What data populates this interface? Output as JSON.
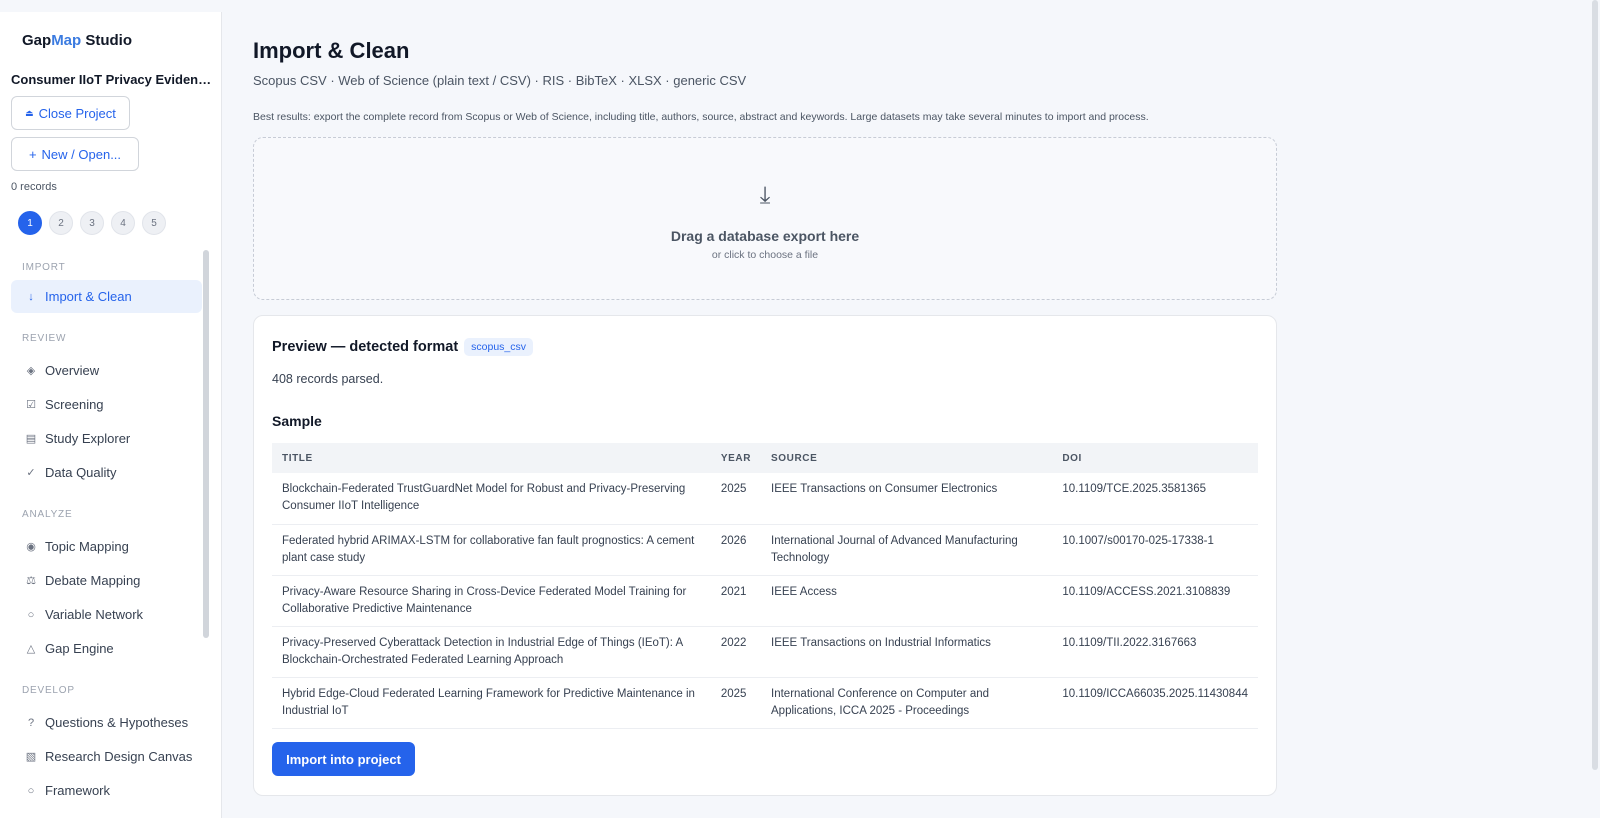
{
  "app": {
    "brand_primary": "Gap",
    "brand_accent": "Map",
    "brand_suffix": " Studio"
  },
  "project": {
    "name": "Consumer IIoT Privacy Evidence ...",
    "close_label": "Close Project",
    "new_label": "New / Open...",
    "records": "0 records"
  },
  "steps": [
    "1",
    "2",
    "3",
    "4",
    "5"
  ],
  "nav": {
    "import_section": "IMPORT",
    "import_clean": "Import & Clean",
    "review_section": "REVIEW",
    "overview": "Overview",
    "screening": "Screening",
    "study_explorer": "Study Explorer",
    "data_quality": "Data Quality",
    "analyze_section": "ANALYZE",
    "topic_mapping": "Topic Mapping",
    "debate_mapping": "Debate Mapping",
    "variable_network": "Variable Network",
    "gap_engine": "Gap Engine",
    "develop_section": "DEVELOP",
    "questions": "Questions & Hypotheses",
    "research_design": "Research Design Canvas",
    "framework": "Framework"
  },
  "main": {
    "title": "Import & Clean",
    "formats": "Scopus CSV · Web of Science (plain text / CSV) · RIS · BibTeX · XLSX · generic CSV",
    "hint": "Best results: export the complete record from Scopus or Web of Science, including title, authors, source, abstract and keywords. Large datasets may take several minutes to import and process.",
    "dropzone_title": "Drag a database export here",
    "dropzone_sub": "or click to choose a file"
  },
  "preview": {
    "title": "Preview — detected format",
    "format_badge": "scopus_csv",
    "parsed": "408 records parsed.",
    "sample_label": "Sample",
    "columns": {
      "title": "TITLE",
      "year": "YEAR",
      "source": "SOURCE",
      "doi": "DOI"
    },
    "rows": [
      {
        "title": "Blockchain-Federated TrustGuardNet Model for Robust and Privacy-Preserving Consumer IIoT Intelligence",
        "year": "2025",
        "source": "IEEE Transactions on Consumer Electronics",
        "doi": "10.1109/TCE.2025.3581365"
      },
      {
        "title": "Federated hybrid ARIMAX-LSTM for collaborative fan fault prognostics: A cement plant case study",
        "year": "2026",
        "source": "International Journal of Advanced Manufacturing Technology",
        "doi": "10.1007/s00170-025-17338-1"
      },
      {
        "title": "Privacy-Aware Resource Sharing in Cross-Device Federated Model Training for Collaborative Predictive Maintenance",
        "year": "2021",
        "source": "IEEE Access",
        "doi": "10.1109/ACCESS.2021.3108839"
      },
      {
        "title": "Privacy-Preserved Cyberattack Detection in Industrial Edge of Things (IEoT): A Blockchain-Orchestrated Federated Learning Approach",
        "year": "2022",
        "source": "IEEE Transactions on Industrial Informatics",
        "doi": "10.1109/TII.2022.3167663"
      },
      {
        "title": "Hybrid Edge-Cloud Federated Learning Framework for Predictive Maintenance in Industrial IoT",
        "year": "2025",
        "source": "International Conference on Computer and Applications, ICCA 2025 - Proceedings",
        "doi": "10.1109/ICCA66035.2025.11430844"
      }
    ],
    "import_button": "Import into project"
  },
  "colors": {
    "accent": "#2563eb",
    "active_bg": "#eaf1fd"
  }
}
